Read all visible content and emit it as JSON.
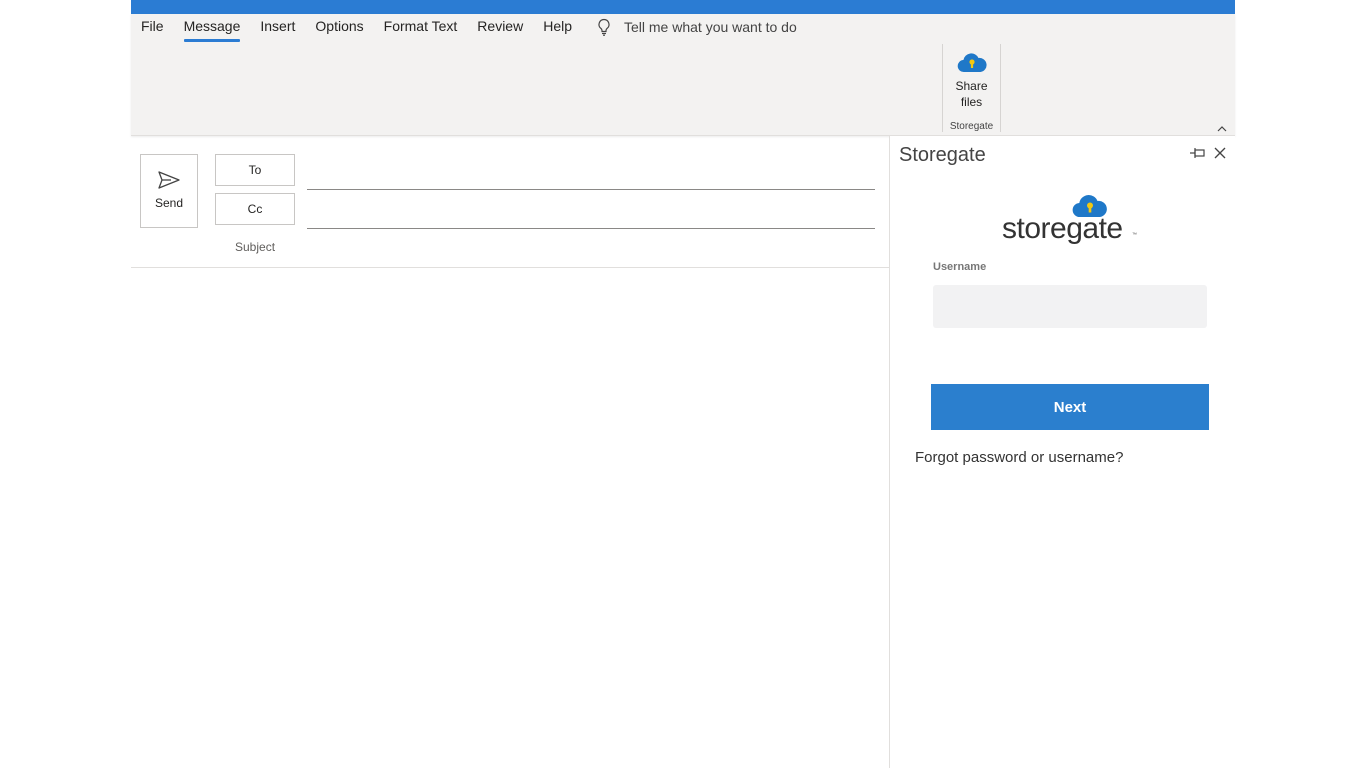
{
  "colors": {
    "titlebar": "#2b7cd3",
    "accent": "#2b7fce",
    "ribbon_bg": "#f3f2f1"
  },
  "ribbon": {
    "tabs": [
      {
        "label": "File"
      },
      {
        "label": "Message",
        "active": true
      },
      {
        "label": "Insert"
      },
      {
        "label": "Options"
      },
      {
        "label": "Format Text"
      },
      {
        "label": "Review"
      },
      {
        "label": "Help"
      }
    ],
    "tell_me": "Tell me what you want to do",
    "share_files": {
      "line1": "Share",
      "line2": "files",
      "icon": "cloud-lock-icon"
    },
    "group_label": "Storegate"
  },
  "compose": {
    "send_label": "Send",
    "to_label": "To",
    "cc_label": "Cc",
    "subject_label": "Subject"
  },
  "pane": {
    "title": "Storegate",
    "logo_text": "storegate",
    "logo_tm": "™",
    "username_label": "Username",
    "username_value": "",
    "next_label": "Next",
    "forgot_link": "Forgot password or username?"
  }
}
